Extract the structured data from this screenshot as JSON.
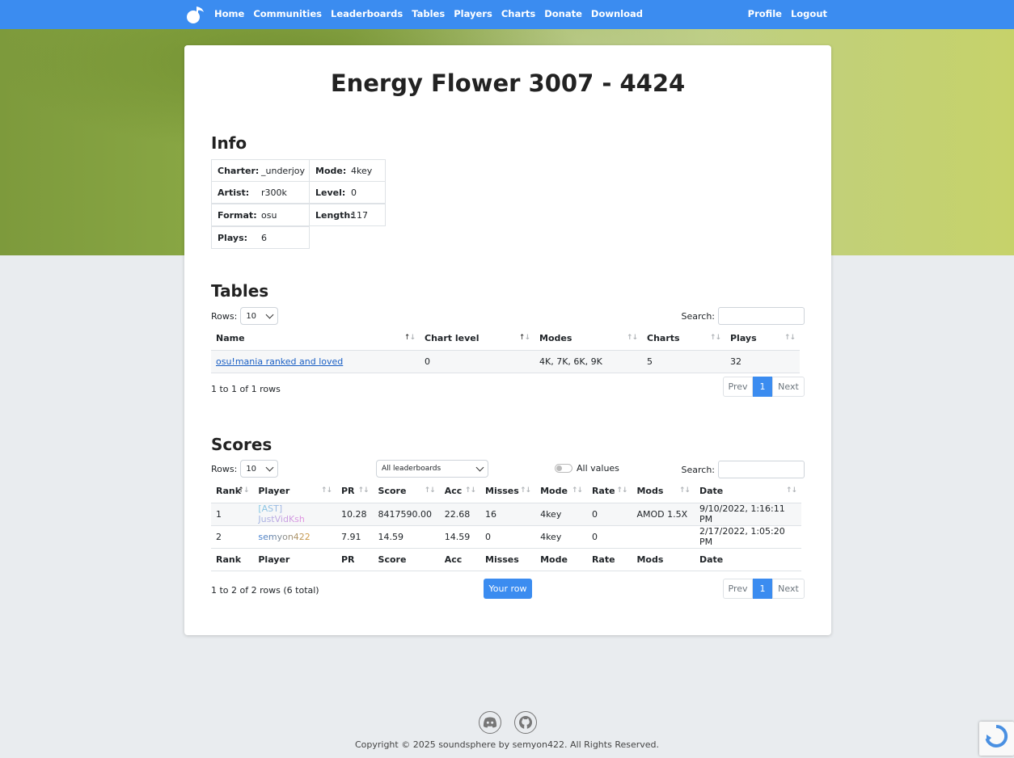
{
  "nav": {
    "links": [
      "Home",
      "Communities",
      "Leaderboards",
      "Tables",
      "Players",
      "Charts",
      "Donate",
      "Download"
    ],
    "right": [
      "Profile",
      "Logout"
    ]
  },
  "page_title": "Energy Flower 3007 - 4424",
  "info": {
    "heading": "Info",
    "charter_label": "Charter:",
    "charter": "_underjoy",
    "artist_label": "Artist:",
    "artist": "r300k",
    "format_label": "Format:",
    "format": "osu",
    "plays_label": "Plays:",
    "plays": "6",
    "mode_label": "Mode:",
    "mode": "4key",
    "level_label": "Level:",
    "level": "0",
    "length_label": "Length:",
    "length": "117"
  },
  "tables": {
    "heading": "Tables",
    "rows_label": "Rows:",
    "rows_value": "10",
    "search_label": "Search:",
    "columns": [
      "Name",
      "Chart level",
      "Modes",
      "Charts",
      "Plays"
    ],
    "rows": [
      {
        "name": "osu!mania ranked and loved",
        "chart_level": "0",
        "modes": "4K, 7K, 6K, 9K",
        "charts": "5",
        "plays": "32"
      }
    ],
    "count_text": "1 to 1 of 1 rows",
    "prev": "Prev",
    "page": "1",
    "next": "Next"
  },
  "scores": {
    "heading": "Scores",
    "rows_label": "Rows:",
    "rows_value": "10",
    "leaderboard_select": "All leaderboards",
    "all_values_label": "All values",
    "search_label": "Search:",
    "columns": [
      "Rank",
      "Player",
      "PR",
      "Score",
      "Acc",
      "Misses",
      "Mode",
      "Rate",
      "Mods",
      "Date"
    ],
    "rows": [
      {
        "rank": "1",
        "player": "[AST] JustVidKsh",
        "pr": "10.28",
        "score": "8417590.00",
        "acc": "22.68",
        "misses": "16",
        "mode": "4key",
        "rate": "0",
        "mods": "AMOD 1.5X",
        "date": "9/10/2022, 1:16:11 PM"
      },
      {
        "rank": "2",
        "player": "semyon422",
        "pr": "7.91",
        "score": "14.59",
        "acc": "14.59",
        "misses": "0",
        "mode": "4key",
        "rate": "0",
        "mods": "",
        "date": "2/17/2022, 1:05:20 PM"
      }
    ],
    "count_text": "1 to 2 of 2 rows (6 total)",
    "your_row": "Your row",
    "prev": "Prev",
    "page": "1",
    "next": "Next"
  },
  "footer": {
    "copyright": "Copyright © 2025 soundsphere by semyon422. All Rights Reserved.",
    "icons": [
      "discord-icon",
      "github-icon"
    ]
  },
  "colors": {
    "accent": "#3b8cf0",
    "player1_gradient": [
      "#7ec8e3",
      "#e38ee0"
    ],
    "player2_gradient": [
      "#3a7bd5",
      "#d69a3a"
    ]
  }
}
